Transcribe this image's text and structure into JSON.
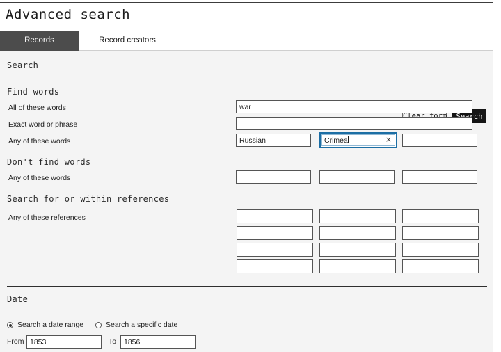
{
  "page": {
    "title": "Advanced search"
  },
  "tabs": [
    {
      "label": "Records",
      "active": true
    },
    {
      "label": "Record creators",
      "active": false
    }
  ],
  "search_section": {
    "heading": "Search",
    "clear_form_label": "Clear form",
    "search_label": "Search"
  },
  "find_words": {
    "heading": "Find words",
    "rows": [
      {
        "label": "All of these words",
        "value": "war"
      },
      {
        "label": "Exact word or phrase",
        "value": ""
      }
    ],
    "any_words": {
      "label": "Any of these words",
      "values": [
        "Russian",
        "Crimea",
        ""
      ],
      "focused_index": 1,
      "clear_icon": "×"
    }
  },
  "dont_find_words": {
    "heading": "Don't find words",
    "label": "Any of these words",
    "values": [
      "",
      "",
      ""
    ]
  },
  "references": {
    "heading": "Search for or within references",
    "label": "Any of these references",
    "rows": [
      [
        "",
        "",
        ""
      ],
      [
        "",
        "",
        ""
      ],
      [
        "",
        "",
        ""
      ],
      [
        "",
        "",
        ""
      ]
    ]
  },
  "date": {
    "heading": "Date",
    "options": [
      {
        "label": "Search a date range",
        "selected": true
      },
      {
        "label": "Search a specific date",
        "selected": false
      }
    ],
    "from_label": "From",
    "from_value": "1853",
    "to_label": "To",
    "to_value": "1856"
  },
  "colors": {
    "focus_border": "#1c6ea4",
    "active_tab_bg": "#4c4c4c",
    "panel_bg": "#f4f4f4",
    "search_button_bg": "#151515"
  }
}
